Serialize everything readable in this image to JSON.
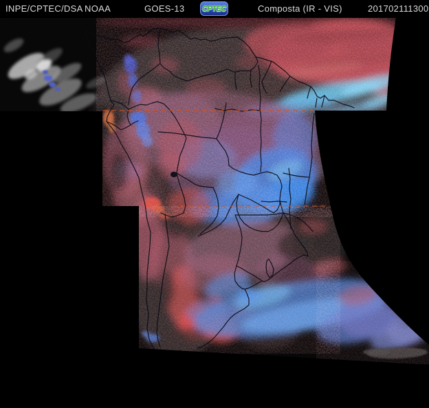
{
  "header": {
    "agency": "INPE/CPTEC/DSA",
    "network": "NOAA",
    "satellite": "GOES-13",
    "logo_text": "CPTEC",
    "product": "Composta (IR - VIS)",
    "timestamp": "201702111300"
  },
  "map": {
    "kind": "geostationary satellite composite over South America",
    "gridline_color": "#d4521e",
    "colors": {
      "header_background": "#000000",
      "header_text": "#dcdcdc",
      "logo_blue": "#2440a8",
      "logo_green": "#2fae2f",
      "cold_cloud_blue": "#3a7ce0",
      "high_cloud_cyan": "#6ec0ee",
      "warm_cloud_red": "#b4454e",
      "visible_cloud_gray": "#c2c2c2",
      "clear_land_dark": "#2b2626",
      "border_line": "#0b0b16",
      "no_data_black": "#000000"
    }
  }
}
